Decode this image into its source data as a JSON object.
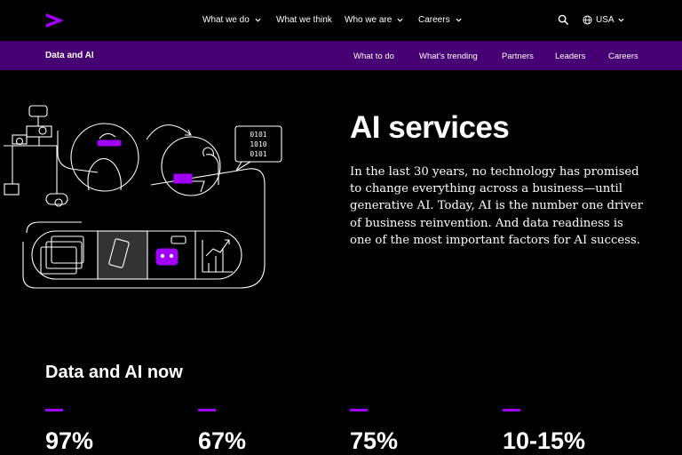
{
  "header": {
    "logo_icon": "accenture-greater-than-icon",
    "brand_color": "#a100ff",
    "nav": [
      {
        "label": "What we do"
      },
      {
        "label": "What we think"
      },
      {
        "label": "Who we are"
      },
      {
        "label": "Careers"
      }
    ],
    "search_icon": "search-icon",
    "country": "USA"
  },
  "subnav": {
    "title": "Data and AI",
    "background": "#460073",
    "items": [
      {
        "label": "What to do"
      },
      {
        "label": "What’s trending"
      },
      {
        "label": "Partners"
      },
      {
        "label": "Leaders"
      },
      {
        "label": "Careers"
      }
    ]
  },
  "hero": {
    "title": "AI services",
    "body": "In the last 30 years, no technology has promised to change everything across a business—until generative AI. Today, AI is the number one driver of business reinvention. And data readiness is one of the most important factors for AI success.",
    "illustration_codes": [
      "0101",
      "1010",
      "0101"
    ]
  },
  "stats": {
    "heading": "Data and AI now",
    "items": [
      {
        "value": "97%"
      },
      {
        "value": "67%"
      },
      {
        "value": "75%"
      },
      {
        "value": "10-15%"
      }
    ]
  }
}
